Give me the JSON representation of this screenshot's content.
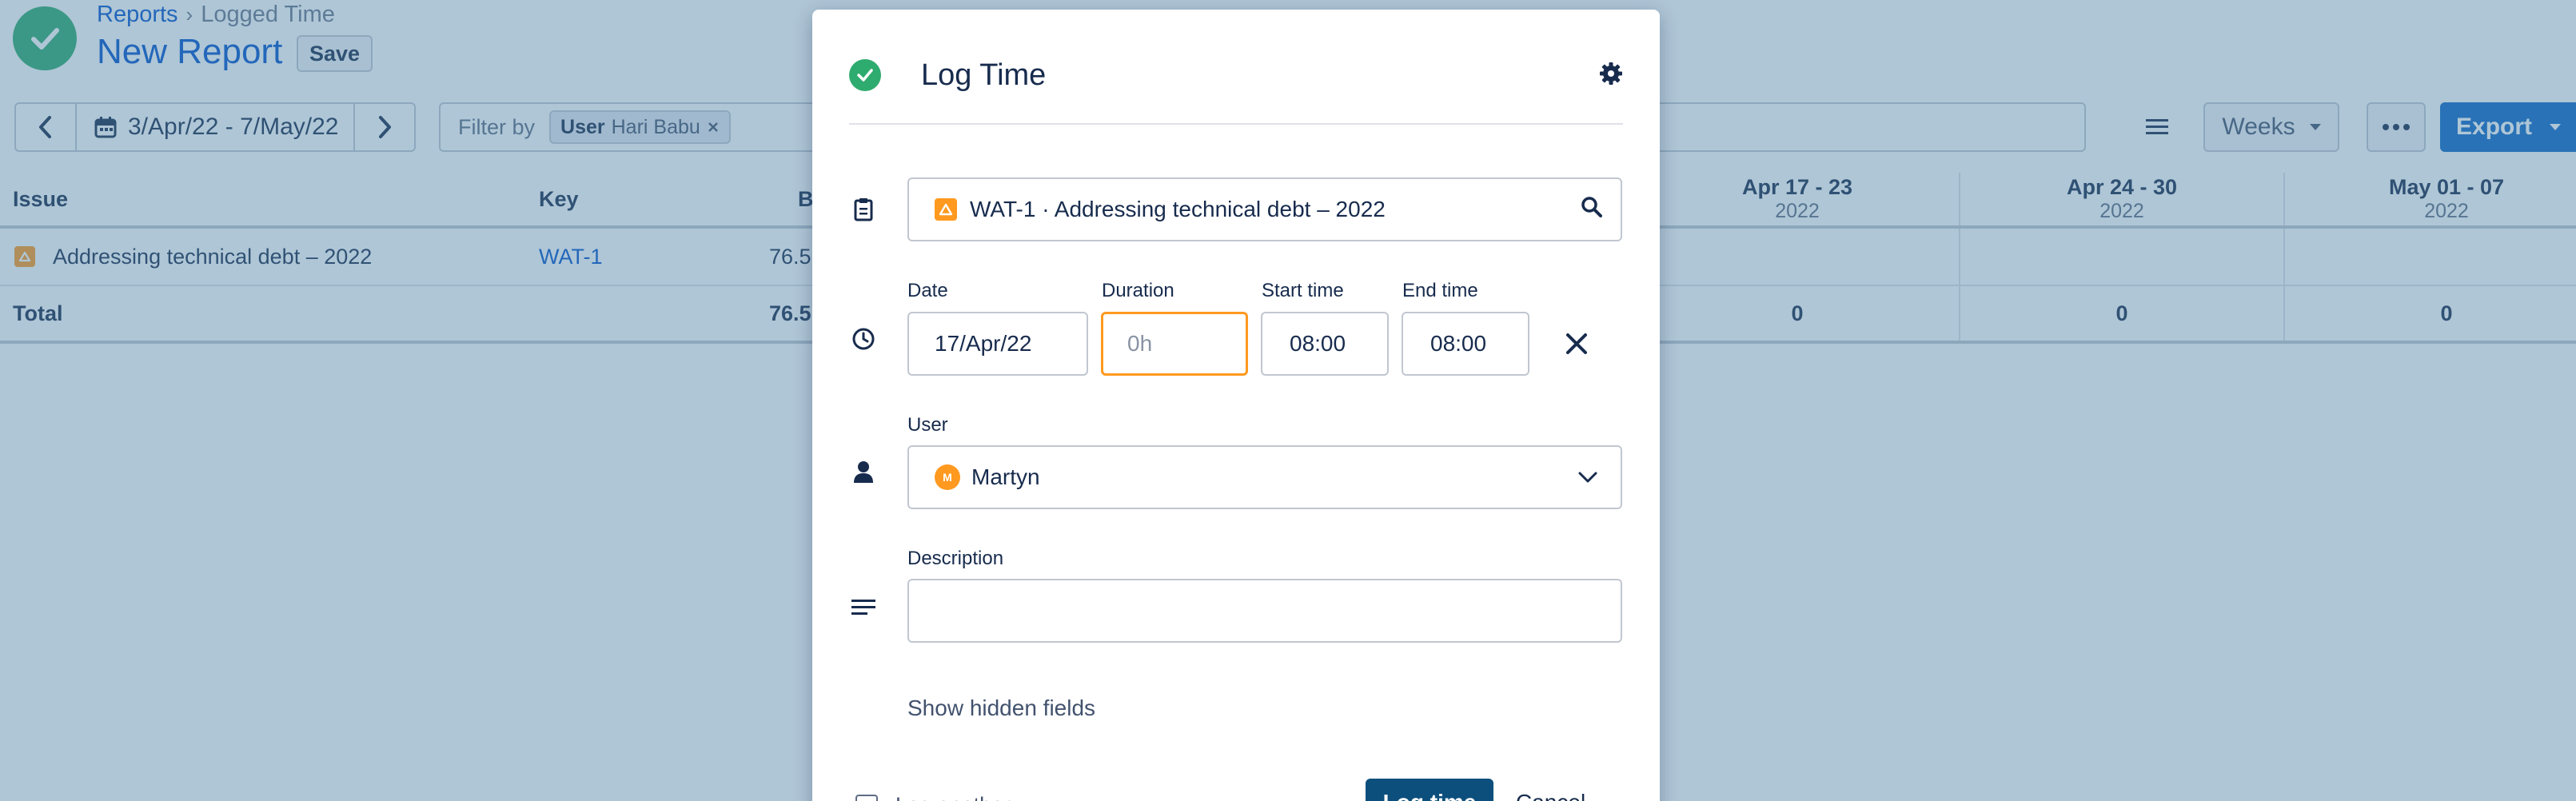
{
  "header": {
    "breadcrumb": [
      "Reports",
      "Logged Time"
    ],
    "title": "New Report",
    "save_label": "Save"
  },
  "toolbar": {
    "date_range": "3/Apr/22 - 7/May/22",
    "filter_label": "Filter by",
    "filter_chip_key": "User",
    "filter_chip_value": "Hari Babu",
    "weeks_label": "Weeks",
    "export_label": "Export"
  },
  "table": {
    "columns": {
      "issue": "Issue",
      "key": "Key",
      "b": "B"
    },
    "weeks": [
      {
        "range": "Apr 17 - 23",
        "year": "2022"
      },
      {
        "range": "Apr 24 - 30",
        "year": "2022"
      },
      {
        "range": "May 01 - 07",
        "year": "2022"
      }
    ],
    "rows": [
      {
        "issue": "Addressing technical debt – 2022",
        "key": "WAT-1",
        "value": "76.5"
      }
    ],
    "total": {
      "label": "Total",
      "value": "76.5",
      "week_totals": [
        "0",
        "0",
        "0"
      ]
    }
  },
  "dialog": {
    "title": "Log Time",
    "issue_value": "WAT-1 · Addressing technical debt – 2022",
    "labels": {
      "date": "Date",
      "duration": "Duration",
      "start_time": "Start time",
      "end_time": "End time",
      "user": "User",
      "description": "Description"
    },
    "date_value": "17/Apr/22",
    "duration_placeholder": "0h",
    "start_time_value": "08:00",
    "end_time_value": "08:00",
    "user_initial": "M",
    "user_value": "Martyn",
    "show_hidden": "Show hidden fields",
    "log_another": "Log another",
    "log_time_button": "Log time",
    "cancel_button": "Cancel"
  },
  "colors": {
    "accent": "#0c66c7",
    "success": "#2eab6e",
    "warning": "#ff991f",
    "overlay": "#4e80a4"
  }
}
